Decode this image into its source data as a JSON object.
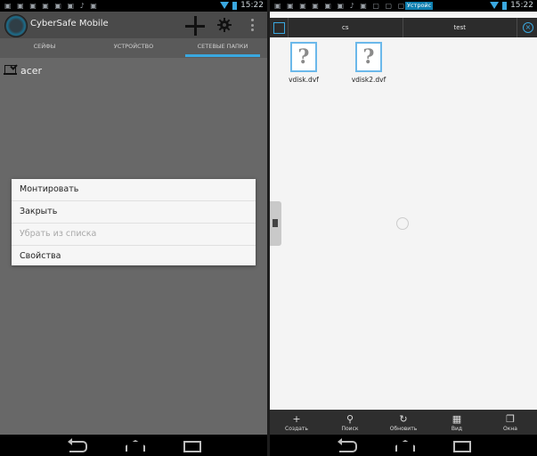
{
  "left": {
    "status": {
      "time": "15:22"
    },
    "app_title": "CyberSafe Mobile",
    "tabs": [
      "СЕЙФЫ",
      "УСТРОЙСТВО",
      "СЕТЕВЫЕ ПАПКИ"
    ],
    "active_tab": 2,
    "list": [
      {
        "label": "acer"
      }
    ],
    "dialog": {
      "items": [
        {
          "label": "Монтировать",
          "enabled": true
        },
        {
          "label": "Закрыть",
          "enabled": true
        },
        {
          "label": "Убрать из списка",
          "enabled": false
        },
        {
          "label": "Свойства",
          "enabled": true
        }
      ]
    }
  },
  "right": {
    "status": {
      "time": "15:22",
      "badge": "Устройс"
    },
    "tabs": [
      "cs",
      "test"
    ],
    "files": [
      {
        "name": "vdisk.dvf"
      },
      {
        "name": "vdisk2.dvf"
      }
    ],
    "bottombar": [
      "Создать",
      "Поиск",
      "Обновить",
      "Вид",
      "Окна"
    ]
  },
  "colors": {
    "accent": "#3aa8e0",
    "dim_overlay": "#686868"
  }
}
